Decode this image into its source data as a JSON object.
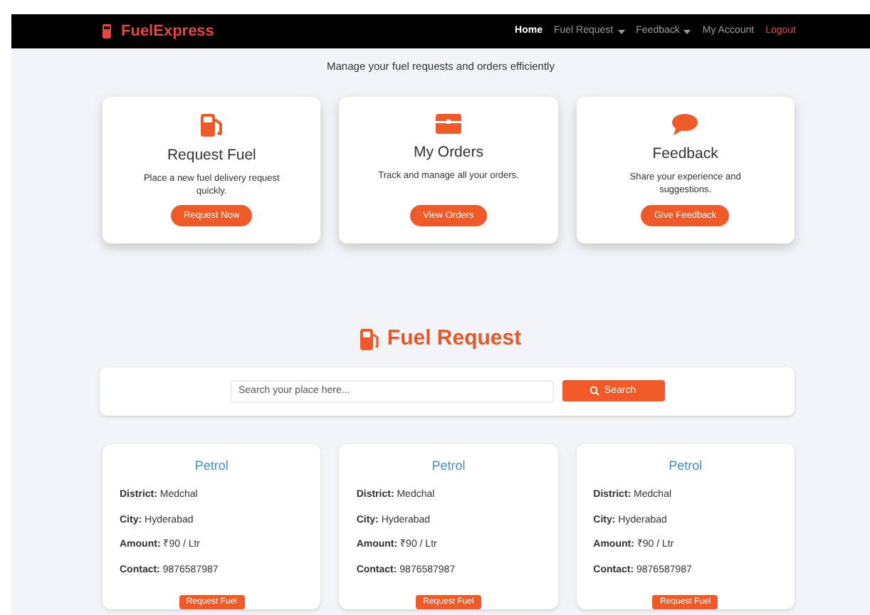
{
  "navbar": {
    "brand": "FuelExpress",
    "items": [
      {
        "label": "Home",
        "kind": "link",
        "selected": true,
        "dropdown": false
      },
      {
        "label": "Fuel Request",
        "kind": "link",
        "selected": false,
        "dropdown": true
      },
      {
        "label": "Feedback",
        "kind": "link",
        "selected": false,
        "dropdown": true
      },
      {
        "label": "My Account",
        "kind": "link",
        "selected": false,
        "dropdown": false
      },
      {
        "label": "Logout",
        "kind": "logout",
        "selected": false,
        "dropdown": false
      }
    ]
  },
  "subtitle": "Manage your fuel requests and orders efficiently",
  "feature_cards": [
    {
      "kind": "fuel",
      "title": "Request Fuel",
      "text": "Place a new fuel delivery request quickly.",
      "button": "Request Now"
    },
    {
      "kind": "box",
      "title": "My Orders",
      "text": "Track and manage all your orders.",
      "button": "View Orders"
    },
    {
      "kind": "chat",
      "title": "Feedback",
      "text": "Share your experience and suggestions.",
      "button": "Give Feedback"
    }
  ],
  "fuel_request": {
    "heading": "Fuel Request",
    "search": {
      "placeholder": "Search your place here...",
      "button": "Search"
    }
  },
  "listings": [
    {
      "title": "Petrol",
      "fields": [
        {
          "label": "District:",
          "value": "Medchal"
        },
        {
          "label": "City:",
          "value": "Hyderabad"
        },
        {
          "label": "Amount:",
          "value": "₹90 / Ltr"
        },
        {
          "label": "Contact:",
          "value": "9876587987"
        }
      ],
      "button": "Request Fuel"
    },
    {
      "title": "Petrol",
      "fields": [
        {
          "label": "District:",
          "value": "Medchal"
        },
        {
          "label": "City:",
          "value": "Hyderabad"
        },
        {
          "label": "Amount:",
          "value": "₹90 / Ltr"
        },
        {
          "label": "Contact:",
          "value": "9876587987"
        }
      ],
      "button": "Request Fuel"
    },
    {
      "title": "Petrol",
      "fields": [
        {
          "label": "District:",
          "value": "Medchal"
        },
        {
          "label": "City:",
          "value": "Hyderabad"
        },
        {
          "label": "Amount:",
          "value": "₹90 / Ltr"
        },
        {
          "label": "Contact:",
          "value": "9876587987"
        }
      ],
      "button": "Request Fuel"
    }
  ]
}
